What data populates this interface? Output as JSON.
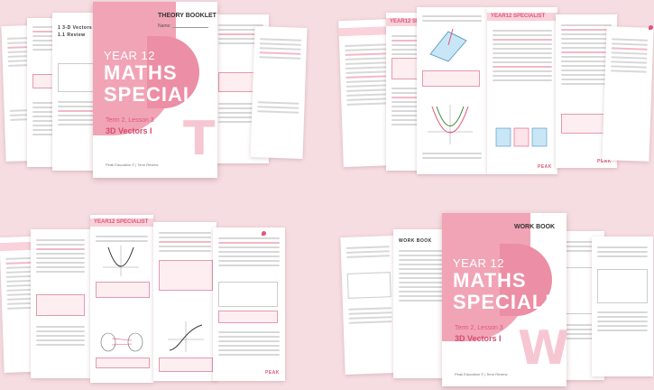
{
  "theory_cover": {
    "booklet_title": "THEORY BOOKLET",
    "name_label": "Name:",
    "year": "YEAR 12",
    "subject_line1": "MATHS",
    "subject_line2": "SPECIALIST",
    "term": "Term 2, Lesson 3",
    "topic": "3D Vectors I",
    "letter": "T",
    "publisher": "Peak Education © | Term Review"
  },
  "work_cover": {
    "booklet_title": "WORK BOOK",
    "year": "YEAR 12",
    "subject_line1": "MATHS",
    "subject_line2": "SPECIALIST",
    "term": "Term 2, Lesson 3",
    "topic": "3D Vectors I",
    "letter": "W",
    "publisher": "Peak Education © | Term Review"
  },
  "page_headers": {
    "year12_specialist": "YEAR12 SPECIALIST",
    "section_3d_vectors": "1  3-D Vectors",
    "review": "1.1  Review"
  },
  "logo": {
    "text": "PEAK"
  },
  "colors": {
    "accent": "#e0567a",
    "light_pink": "#f1a4b6",
    "background": "#f6dde2"
  }
}
